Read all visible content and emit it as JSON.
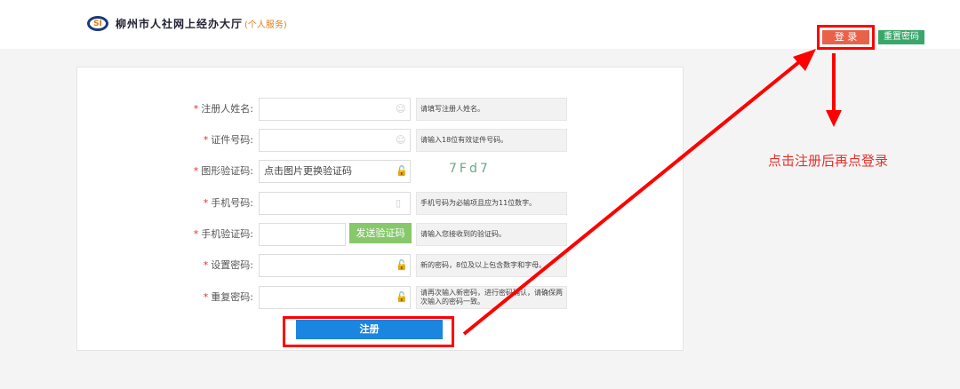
{
  "header": {
    "logo_mark": "SI",
    "title": "柳州市人社网上经办大厅",
    "subtitle": "(个人服务)",
    "login": "登 录",
    "reset_password": "重置密码"
  },
  "form": {
    "rows": [
      {
        "label": "注册人姓名:",
        "value": "",
        "hint": "请填写注册人姓名。",
        "icon": "user-icon"
      },
      {
        "label": "证件号码:",
        "value": "",
        "hint": "请输入18位有效证件号码。",
        "icon": "user-icon"
      },
      {
        "label": "图形验证码:",
        "value": "点击图片更换验证码",
        "captcha": "7Fd7",
        "icon": "lock-icon"
      },
      {
        "label": "手机号码:",
        "value": "",
        "hint": "手机号码为必输项且应为11位数字。",
        "icon": "phone-icon"
      },
      {
        "label": "手机验证码:",
        "value": "",
        "hint": "请输入您接收到的验证码。",
        "send_button": "发送验证码"
      },
      {
        "label": "设置密码:",
        "value": "",
        "hint": "新的密码，8位及以上包含数字和字母。",
        "icon": "lock-icon"
      },
      {
        "label": "重复密码:",
        "value": "",
        "hint": "请再次输入新密码，进行密码确认，请确保两次输入的密码一致。",
        "icon": "lock-icon"
      }
    ],
    "required_mark": "*",
    "register": "注册"
  },
  "annotation": {
    "note": "点击注册后再点登录",
    "color": "#ee1111"
  }
}
